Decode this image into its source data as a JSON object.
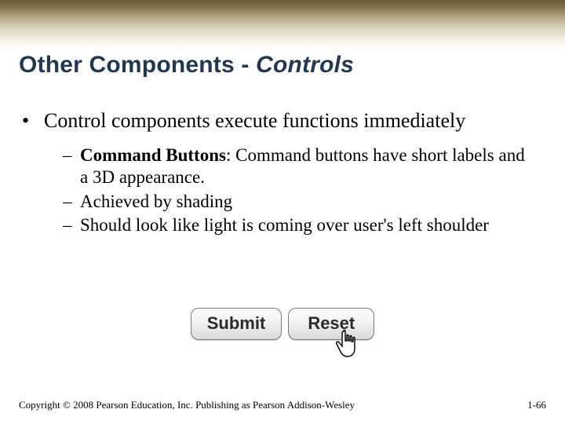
{
  "title": {
    "prefix": "Other Components - ",
    "italic": "Controls"
  },
  "bullet": {
    "mark": "•",
    "text": "Control components execute functions immediately"
  },
  "subitems": [
    {
      "dash": "–",
      "bold": "Command Buttons",
      "rest": ": Command buttons have short labels and a 3D appearance."
    },
    {
      "dash": "–",
      "bold": "",
      "rest": "Achieved by shading"
    },
    {
      "dash": "–",
      "bold": "",
      "rest": "Should look like light is coming over user's left shoulder"
    }
  ],
  "buttons": {
    "submit": "Submit",
    "reset": "Reset"
  },
  "footer": {
    "copyright": "Copyright © 2008 Pearson Education, Inc. Publishing as Pearson Addison-Wesley",
    "page": "1-66"
  }
}
